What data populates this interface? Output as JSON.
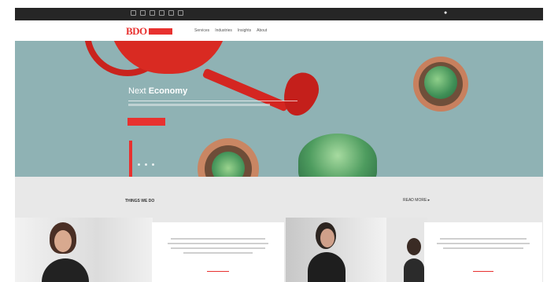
{
  "topbar": {
    "social_icons": [
      "facebook-icon",
      "twitter-icon",
      "linkedin-icon",
      "youtube-icon",
      "instagram-icon",
      "rss-icon"
    ],
    "contact_text": "",
    "search_icon": "search-icon"
  },
  "nav": {
    "logo_text": "BDO",
    "logo_tagline": "",
    "links": [
      {
        "label": "Services"
      },
      {
        "label": "Industries"
      },
      {
        "label": "Insights"
      },
      {
        "label": "About"
      }
    ],
    "right_items": [
      {
        "label": ""
      },
      {
        "label": ""
      }
    ]
  },
  "hero": {
    "title_prefix": "Next",
    "title_accent": "Economy",
    "button_label": "",
    "background_color": "#8fb2b4",
    "accent_color": "#e8312f"
  },
  "section": {
    "title": "THINGS WE DO",
    "more_label": "READ MORE ▸"
  },
  "cards": [
    {
      "title": "",
      "link_label": ""
    },
    {
      "title": "",
      "link_label": ""
    }
  ],
  "colors": {
    "brand_red": "#e8312f",
    "topbar": "#262626",
    "section_bg": "#e8e8e8"
  }
}
